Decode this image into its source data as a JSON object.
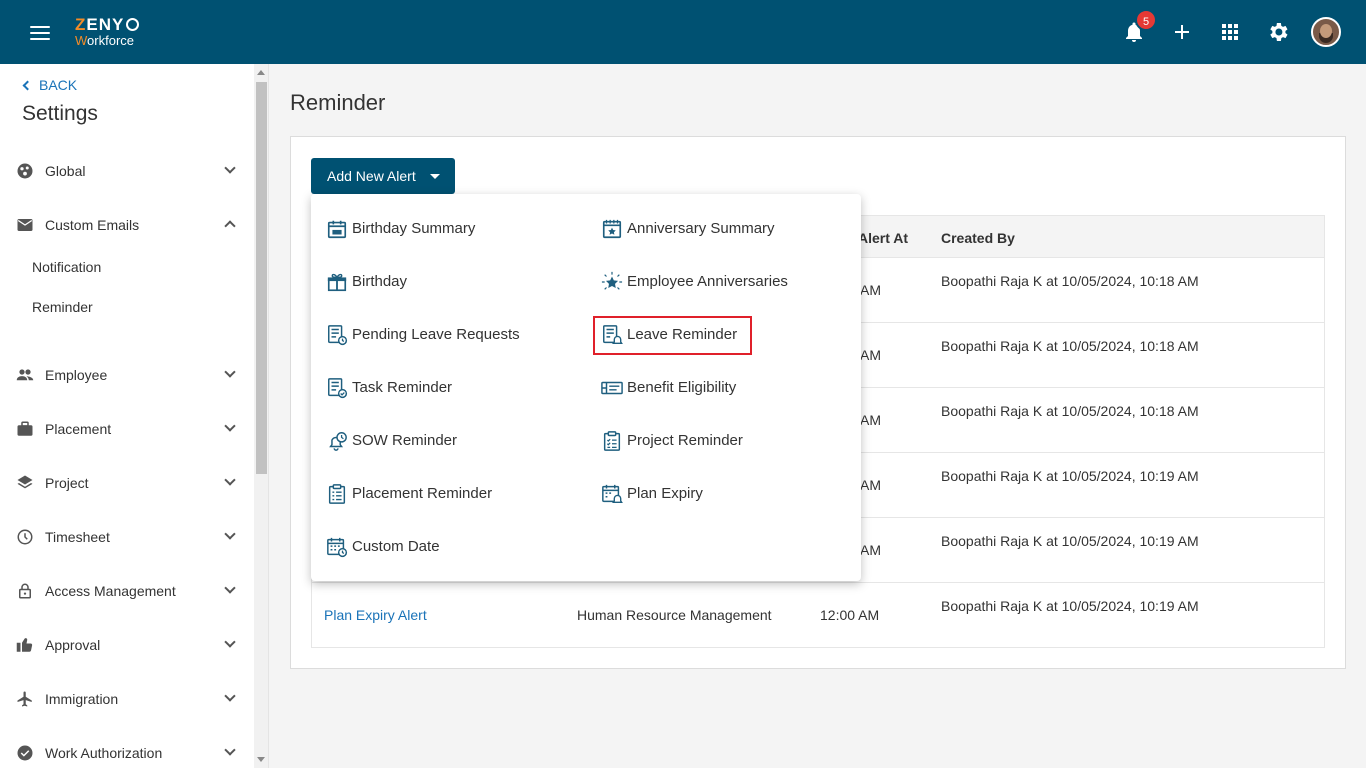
{
  "header": {
    "logo_line1_accent": "Z",
    "logo_line1": "ENY",
    "logo_line2_accent": "W",
    "logo_line2": "orkforce",
    "notification_count": "5",
    "icons": [
      "menu-icon",
      "bell-icon",
      "plus-icon",
      "apps-grid-icon",
      "gear-icon",
      "avatar"
    ]
  },
  "sidebar": {
    "back_label": "BACK",
    "title": "Settings",
    "items": [
      {
        "label": "Global",
        "icon": "globe-icon",
        "expanded": false
      },
      {
        "label": "Custom Emails",
        "icon": "mail-icon",
        "expanded": true
      },
      {
        "label": "Employee",
        "icon": "people-icon",
        "expanded": false
      },
      {
        "label": "Placement",
        "icon": "briefcase-icon",
        "expanded": false
      },
      {
        "label": "Project",
        "icon": "layers-icon",
        "expanded": false
      },
      {
        "label": "Timesheet",
        "icon": "clock-icon",
        "expanded": false
      },
      {
        "label": "Access Management",
        "icon": "lock-icon",
        "expanded": false
      },
      {
        "label": "Approval",
        "icon": "thumbs-up-icon",
        "expanded": false
      },
      {
        "label": "Immigration",
        "icon": "airplane-icon",
        "expanded": false
      },
      {
        "label": "Work Authorization",
        "icon": "badge-icon",
        "expanded": false
      }
    ],
    "sub_items": [
      "Notification",
      "Reminder"
    ]
  },
  "main": {
    "title": "Reminder",
    "add_button": "Add New Alert",
    "table": {
      "headers": [
        "Alert At",
        "Created By"
      ],
      "rows": [
        {
          "alert_at": "AM",
          "created_by": "Boopathi Raja K at 10/05/2024, 10:18 AM"
        },
        {
          "alert_at": "AM",
          "created_by": "Boopathi Raja K at 10/05/2024, 10:18 AM"
        },
        {
          "alert_at": "AM",
          "created_by": "Boopathi Raja K at 10/05/2024, 10:18 AM"
        },
        {
          "alert_at": "AM",
          "created_by": "Boopathi Raja K at 10/05/2024, 10:19 AM"
        },
        {
          "alert_at": "AM",
          "created_by": "Boopathi Raja K at 10/05/2024, 10:19 AM"
        },
        {
          "name": "Plan Expiry Alert",
          "module": "Human Resource Management",
          "alert_at": "12:00 AM",
          "created_by": "Boopathi Raja K at 10/05/2024, 10:19 AM"
        }
      ]
    },
    "dropdown": {
      "left": [
        {
          "label": "Birthday Summary",
          "icon": "calendar-icon"
        },
        {
          "label": "Birthday",
          "icon": "gift-icon"
        },
        {
          "label": "Pending Leave Requests",
          "icon": "list-clock-icon"
        },
        {
          "label": "Task Reminder",
          "icon": "task-list-icon"
        },
        {
          "label": "SOW Reminder",
          "icon": "bell-clock-icon"
        },
        {
          "label": "Placement Reminder",
          "icon": "clipboard-icon"
        },
        {
          "label": "Custom Date",
          "icon": "calendar-clock-icon"
        }
      ],
      "right": [
        {
          "label": "Anniversary Summary",
          "icon": "calendar-star-icon"
        },
        {
          "label": "Employee Anniversaries",
          "icon": "star-burst-icon"
        },
        {
          "label": "Leave Reminder",
          "icon": "list-bell-icon",
          "highlighted": true
        },
        {
          "label": "Benefit Eligibility",
          "icon": "ticket-icon"
        },
        {
          "label": "Project Reminder",
          "icon": "clipboard-check-icon"
        },
        {
          "label": "Plan Expiry",
          "icon": "calendar-bell-icon"
        }
      ]
    }
  },
  "colors": {
    "brand": "#005172",
    "accent": "#f28c28",
    "link": "#1a73b8",
    "badge": "#e53935",
    "highlight": "#e0202a"
  }
}
